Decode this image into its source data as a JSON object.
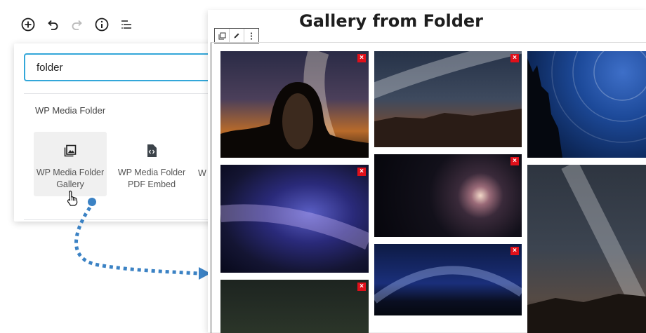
{
  "toolbar": {
    "buttons": [
      "add-block",
      "undo",
      "redo",
      "info",
      "list-view"
    ]
  },
  "inserter": {
    "search_value": "folder",
    "category": "WP Media Folder",
    "blocks": [
      {
        "label_line1": "WP Media Folder",
        "label_line2": "Gallery"
      },
      {
        "label_line1": "WP Media Folder",
        "label_line2": "PDF Embed"
      }
    ],
    "partial_label": "W"
  },
  "editor": {
    "title": "Gallery from Folder",
    "delete_glyph": "×",
    "gallery": [
      "desert-arch-milky-way",
      "canyon-milky-way",
      "star-trails",
      "purple-milky-way",
      "spiral-galaxy",
      "milky-way-right",
      "blue-night-horizon",
      "dark-sky-bottom"
    ]
  },
  "colors": {
    "accent": "#33a7d9",
    "arrow": "#3b82c4",
    "delete": "#e0101a"
  }
}
